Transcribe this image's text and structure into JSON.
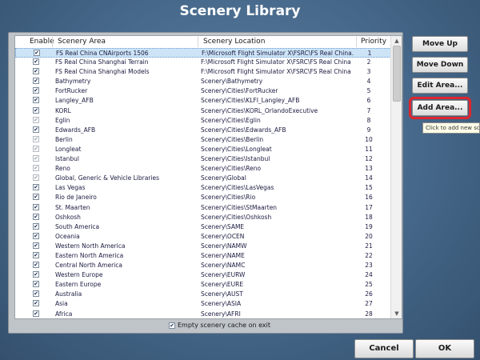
{
  "window": {
    "title": "Scenery Library"
  },
  "columns": {
    "enable": "Enable",
    "area": "Scenery Area",
    "location": "Scenery Location",
    "priority": "Priority"
  },
  "rows": [
    {
      "checked": true,
      "grey": false,
      "area": "FS Real China CNAirports 1506",
      "location": "F:\\Microsoft Flight Simulator X\\FSRC\\FS Real China...",
      "priority": "1"
    },
    {
      "checked": true,
      "grey": false,
      "area": "FS Real China Shanghai Terrain",
      "location": "F:\\Microsoft Flight Simulator X\\FSRC\\FS Real China S...",
      "priority": "2"
    },
    {
      "checked": true,
      "grey": false,
      "area": "FS Real China Shanghai Models",
      "location": "F:\\Microsoft Flight Simulator X\\FSRC\\FS Real China S...",
      "priority": "3"
    },
    {
      "checked": true,
      "grey": false,
      "area": "Bathymetry",
      "location": "Scenery\\Bathymetry",
      "priority": "4"
    },
    {
      "checked": true,
      "grey": false,
      "area": "FortRucker",
      "location": "Scenery\\Cities\\FortRucker",
      "priority": "5"
    },
    {
      "checked": true,
      "grey": false,
      "area": "Langley_AFB",
      "location": "Scenery\\Cities\\KLFI_Langley_AFB",
      "priority": "6"
    },
    {
      "checked": true,
      "grey": false,
      "area": "KORL",
      "location": "Scenery\\Cities\\KORL_OrlandoExecutive",
      "priority": "7"
    },
    {
      "checked": true,
      "grey": true,
      "area": "Eglin",
      "location": "Scenery\\Cities\\Eglin",
      "priority": "8"
    },
    {
      "checked": true,
      "grey": false,
      "area": "Edwards_AFB",
      "location": "Scenery\\Cities\\Edwards_AFB",
      "priority": "9"
    },
    {
      "checked": true,
      "grey": true,
      "area": "Berlin",
      "location": "Scenery\\Cities\\Berlin",
      "priority": "10"
    },
    {
      "checked": true,
      "grey": true,
      "area": "Longleat",
      "location": "Scenery\\Cities\\Longleat",
      "priority": "11"
    },
    {
      "checked": true,
      "grey": true,
      "area": "Istanbul",
      "location": "Scenery\\Cities\\Istanbul",
      "priority": "12"
    },
    {
      "checked": true,
      "grey": true,
      "area": "Reno",
      "location": "Scenery\\Cities\\Reno",
      "priority": "13"
    },
    {
      "checked": true,
      "grey": true,
      "area": "Global, Generic & Vehicle Libraries",
      "location": "Scenery\\Global",
      "priority": "14"
    },
    {
      "checked": true,
      "grey": false,
      "area": "Las Vegas",
      "location": "Scenery\\Cities\\LasVegas",
      "priority": "15"
    },
    {
      "checked": true,
      "grey": false,
      "area": "Rio de Janeiro",
      "location": "Scenery\\Cities\\Rio",
      "priority": "16"
    },
    {
      "checked": true,
      "grey": false,
      "area": "St. Maarten",
      "location": "Scenery\\Cities\\StMaarten",
      "priority": "17"
    },
    {
      "checked": true,
      "grey": false,
      "area": "Oshkosh",
      "location": "Scenery\\Cities\\Oshkosh",
      "priority": "18"
    },
    {
      "checked": true,
      "grey": false,
      "area": "South America",
      "location": "Scenery\\SAME",
      "priority": "19"
    },
    {
      "checked": true,
      "grey": false,
      "area": "Oceania",
      "location": "Scenery\\OCEN",
      "priority": "20"
    },
    {
      "checked": true,
      "grey": false,
      "area": "Western North America",
      "location": "Scenery\\NAMW",
      "priority": "21"
    },
    {
      "checked": true,
      "grey": false,
      "area": "Eastern North America",
      "location": "Scenery\\NAME",
      "priority": "22"
    },
    {
      "checked": true,
      "grey": false,
      "area": "Central North America",
      "location": "Scenery\\NAMC",
      "priority": "23"
    },
    {
      "checked": true,
      "grey": false,
      "area": "Western Europe",
      "location": "Scenery\\EURW",
      "priority": "24"
    },
    {
      "checked": true,
      "grey": false,
      "area": "Eastern Europe",
      "location": "Scenery\\EURE",
      "priority": "25"
    },
    {
      "checked": true,
      "grey": false,
      "area": "Australia",
      "location": "Scenery\\AUST",
      "priority": "26"
    },
    {
      "checked": true,
      "grey": false,
      "area": "Asia",
      "location": "Scenery\\ASIA",
      "priority": "27"
    },
    {
      "checked": true,
      "grey": false,
      "area": "Africa",
      "location": "Scenery\\AFRI",
      "priority": "28"
    }
  ],
  "selected_row": 0,
  "cache": {
    "checked": true,
    "label": "Empty scenery cache on exit"
  },
  "buttons": {
    "move_up": "Move Up",
    "move_down": "Move Down",
    "edit_area": "Edit Area...",
    "add_area": "Add Area...",
    "cancel": "Cancel",
    "ok": "OK"
  },
  "tooltip": {
    "text": "Click to add new sce"
  },
  "colors": {
    "highlight_box": "#e0252b",
    "selected_row": "#cde4f7",
    "background": "#456789"
  }
}
